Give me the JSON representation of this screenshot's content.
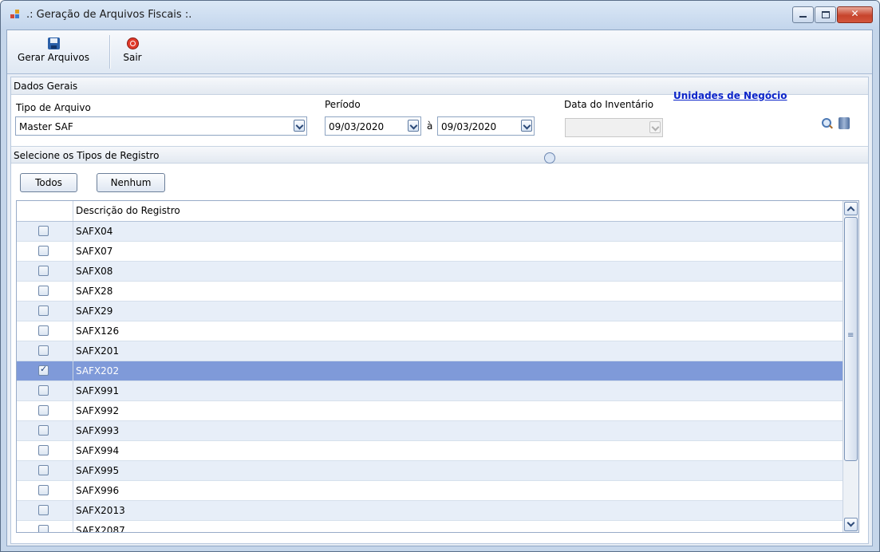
{
  "window": {
    "title": ".: Geração de Arquivos Fiscais :."
  },
  "toolbar": {
    "generate_label": "Gerar Arquivos",
    "exit_label": "Sair"
  },
  "general": {
    "section_title": "Dados Gerais",
    "file_type_label": "Tipo de Arquivo",
    "file_type_value": "Master SAF",
    "period_label": "Período",
    "period_from": "09/03/2020",
    "period_sep": "à",
    "period_to": "09/03/2020",
    "inventory_label": "Data do Inventário",
    "inventory_value": "",
    "business_units_link": "Unidades de Negócio"
  },
  "registers": {
    "section_title": "Selecione os Tipos de Registro",
    "all_button": "Todos",
    "none_button": "Nenhum",
    "column_header": "Descrição do Registro",
    "rows": [
      {
        "label": "SAFX04",
        "checked": false
      },
      {
        "label": "SAFX07",
        "checked": false
      },
      {
        "label": "SAFX08",
        "checked": false
      },
      {
        "label": "SAFX28",
        "checked": false
      },
      {
        "label": "SAFX29",
        "checked": false
      },
      {
        "label": "SAFX126",
        "checked": false
      },
      {
        "label": "SAFX201",
        "checked": false
      },
      {
        "label": "SAFX202",
        "checked": true
      },
      {
        "label": "SAFX991",
        "checked": false
      },
      {
        "label": "SAFX992",
        "checked": false
      },
      {
        "label": "SAFX993",
        "checked": false
      },
      {
        "label": "SAFX994",
        "checked": false
      },
      {
        "label": "SAFX995",
        "checked": false
      },
      {
        "label": "SAFX996",
        "checked": false
      },
      {
        "label": "SAFX2013",
        "checked": false
      },
      {
        "label": "SAFX2087",
        "checked": false
      }
    ]
  },
  "colors": {
    "selected_row": "#7f9ad9",
    "link": "#0b24c9",
    "alt_row": "#e7eef8"
  }
}
